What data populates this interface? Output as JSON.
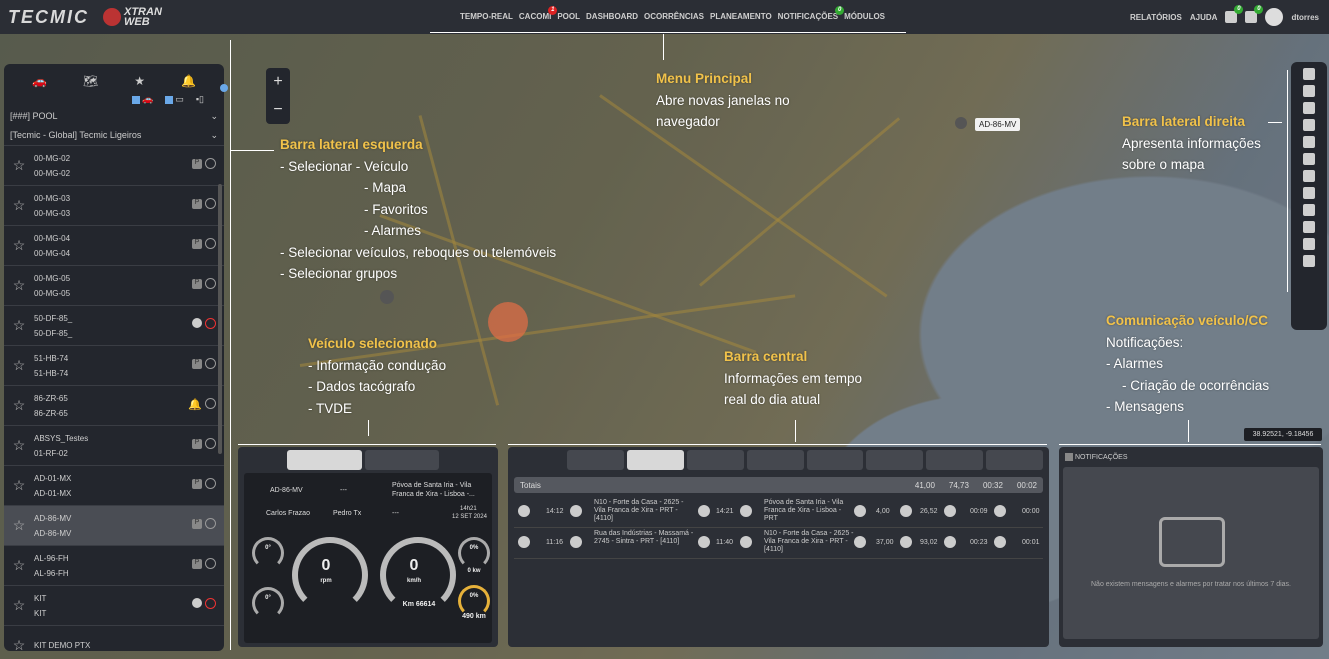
{
  "topbar": {
    "logo": "TECMIC",
    "logo2_line1": "XTRAN",
    "logo2_line2": "WEB",
    "menu": [
      {
        "label": "TEMPO-REAL"
      },
      {
        "label": "CACOMI",
        "badge": "1"
      },
      {
        "label": "POOL"
      },
      {
        "label": "DASHBOARD"
      },
      {
        "label": "OCORRÊNCIAS"
      },
      {
        "label": "PLANEAMENTO"
      },
      {
        "label": "NOTIFICAÇÕES",
        "badge": "0"
      },
      {
        "label": "MÓDULOS"
      }
    ],
    "reports": "RELATÓRIOS",
    "help": "AJUDA",
    "bell_badge": "0",
    "mail_badge": "0",
    "user": "dtorres"
  },
  "sidebar": {
    "filters": [
      {
        "label": "",
        "checked": true
      },
      {
        "label": "",
        "checked": true
      },
      {
        "label": "",
        "checked": false
      }
    ],
    "groups": [
      "[###] POOL",
      "[Tecmic - Global] Tecmic Ligeiros"
    ],
    "vehicles": [
      {
        "name": "00-MG-02",
        "plate": "00-MG-02",
        "status": "p"
      },
      {
        "name": "00-MG-03",
        "plate": "00-MG-03",
        "status": "p"
      },
      {
        "name": "00-MG-04",
        "plate": "00-MG-04",
        "status": "p"
      },
      {
        "name": "00-MG-05",
        "plate": "00-MG-05",
        "status": "p"
      },
      {
        "name": "50-DF-85_",
        "plate": "50-DF-85_",
        "status": "clock"
      },
      {
        "name": "51-HB-74",
        "plate": "51-HB-74",
        "status": "p"
      },
      {
        "name": "86-ZR-65",
        "plate": "86-ZR-65",
        "status": "alarm"
      },
      {
        "name": "ABSYS_Testes",
        "plate": "01-RF-02",
        "status": "p"
      },
      {
        "name": "AD-01-MX",
        "plate": "AD-01-MX",
        "status": "p"
      },
      {
        "name": "AD-86-MV",
        "plate": "AD-86-MV",
        "status": "p",
        "selected": true
      },
      {
        "name": "AL-96-FH",
        "plate": "AL-96-FH",
        "status": "p"
      },
      {
        "name": "KIT",
        "plate": "KIT",
        "status": "clock"
      },
      {
        "name": "KIT DEMO PTX",
        "plate": "",
        "status": ""
      }
    ]
  },
  "map": {
    "vehicle_tag": "AD-86-MV",
    "coords": "38.92521, -9.18456"
  },
  "vehicle_panel": {
    "plate": "AD-86-MV",
    "location": "Póvoa de Santa Iria - Vila Franca de Xira - Lisboa -...",
    "driver1": "Carlos Frazao",
    "driver2": "Pedro Tx",
    "dash1": "---",
    "dash2": "---",
    "time": "14h21",
    "date": "12 SET 2024",
    "rpm_value": "0",
    "rpm_unit": "rpm",
    "speed_value": "0",
    "speed_unit": "km/h",
    "km": "Km 66614",
    "small_left1": "0°",
    "small_left2": "0°",
    "small_right1": "0%",
    "small_right1_unit": "0 kw",
    "fuel": "490 km",
    "fuel_pct": "0%"
  },
  "central_panel": {
    "totals_label": "Totais",
    "totals": [
      "41,00",
      "74,73",
      "00:32",
      "00:02"
    ],
    "rows": [
      {
        "t1": "14:12",
        "from": "N10 - Forte da Casa - 2625 - Vila Franca de Xira - PRT - [4110]",
        "t2": "14:21",
        "to": "Póvoa de Santa Iria - Vila Franca de Xira - Lisboa - PRT",
        "dist": "4,00",
        "speed": "26,52",
        "d1": "00:09",
        "d2": "00:00"
      },
      {
        "t1": "11:16",
        "from": "Rua das Indústrias - Massamá - 2745 - Sintra - PRT - [4110]",
        "t2": "11:40",
        "to": "N10 - Forte da Casa - 2625 - Vila Franca de Xira - PRT - [4110]",
        "dist": "37,00",
        "speed": "93,02",
        "d1": "00:23",
        "d2": "00:01"
      }
    ]
  },
  "notifications_panel": {
    "title": "NOTIFICAÇÕES",
    "empty": "Não existem mensagens e alarmes por tratar nos últimos 7 dias."
  },
  "annotations": {
    "menu_title": "Menu Principal",
    "menu_text": [
      "Abre novas janelas no",
      "navegador"
    ],
    "left_title": "Barra lateral esquerda",
    "left_lines": [
      "- Selecionar - Veículo",
      "- Mapa",
      "- Favoritos",
      "- Alarmes",
      "- Selecionar veículos, reboques ou telemóveis",
      "- Selecionar grupos"
    ],
    "right_title": "Barra lateral direita",
    "right_text": [
      "Apresenta informações",
      "sobre o mapa"
    ],
    "veh_title": "Veículo selecionado",
    "veh_lines": [
      "- Informação condução",
      "- Dados tacógrafo",
      "- TVDE"
    ],
    "central_title": "Barra central",
    "central_text": [
      "Informações em tempo",
      "real do dia atual"
    ],
    "comm_title": "Comunicação veículo/CC",
    "comm_lines": [
      "Notificações:",
      "- Alarmes",
      "- Criação de ocorrências",
      "- Mensagens"
    ]
  },
  "colors": {
    "accent": "#f1c24a",
    "panel": "#2c2f36",
    "topbar": "#2b2e35"
  }
}
